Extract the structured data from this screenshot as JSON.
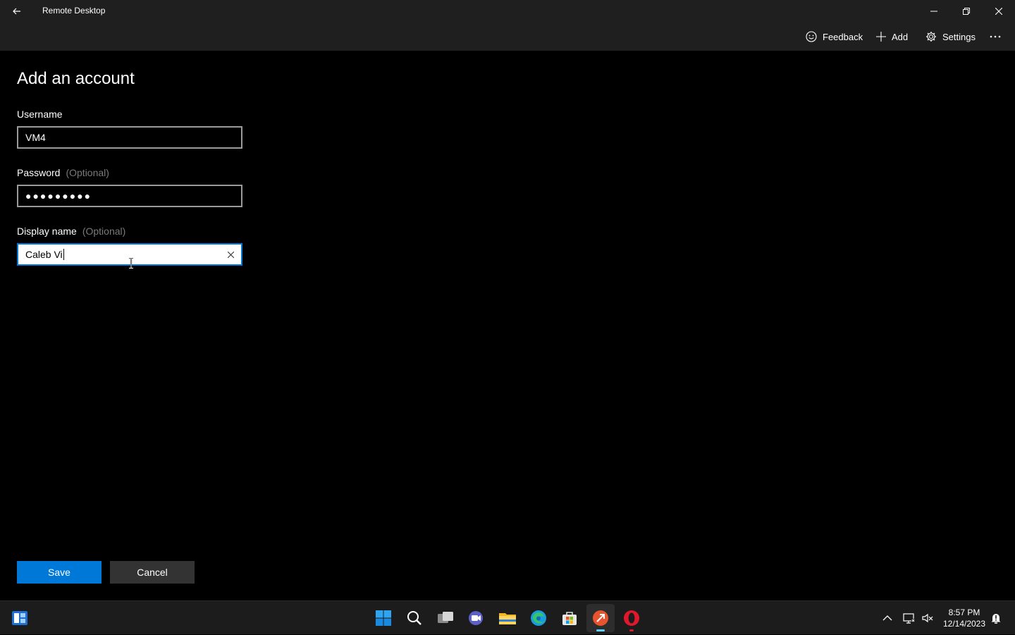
{
  "window": {
    "title": "Remote Desktop"
  },
  "commandbar": {
    "feedback_label": "Feedback",
    "add_label": "Add",
    "settings_label": "Settings"
  },
  "form": {
    "heading": "Add an account",
    "username": {
      "label": "Username",
      "value": "VM4"
    },
    "password": {
      "label": "Password",
      "optional": "(Optional)",
      "value": "●●●●●●●●●"
    },
    "display_name": {
      "label": "Display name",
      "optional": "(Optional)",
      "value": "Caleb Vi"
    },
    "save_label": "Save",
    "cancel_label": "Cancel"
  },
  "taskbar": {
    "icons": [
      "start-icon",
      "windows-logo-icon",
      "search-icon",
      "task-view-icon",
      "chat-icon",
      "file-explorer-icon",
      "edge-icon",
      "store-icon",
      "remote-desktop-icon",
      "opera-icon"
    ],
    "clock_time": "8:57 PM",
    "clock_date": "12/14/2023"
  },
  "colors": {
    "accent": "#0078d7",
    "chrome": "#1f1f1f",
    "background": "#000000"
  }
}
